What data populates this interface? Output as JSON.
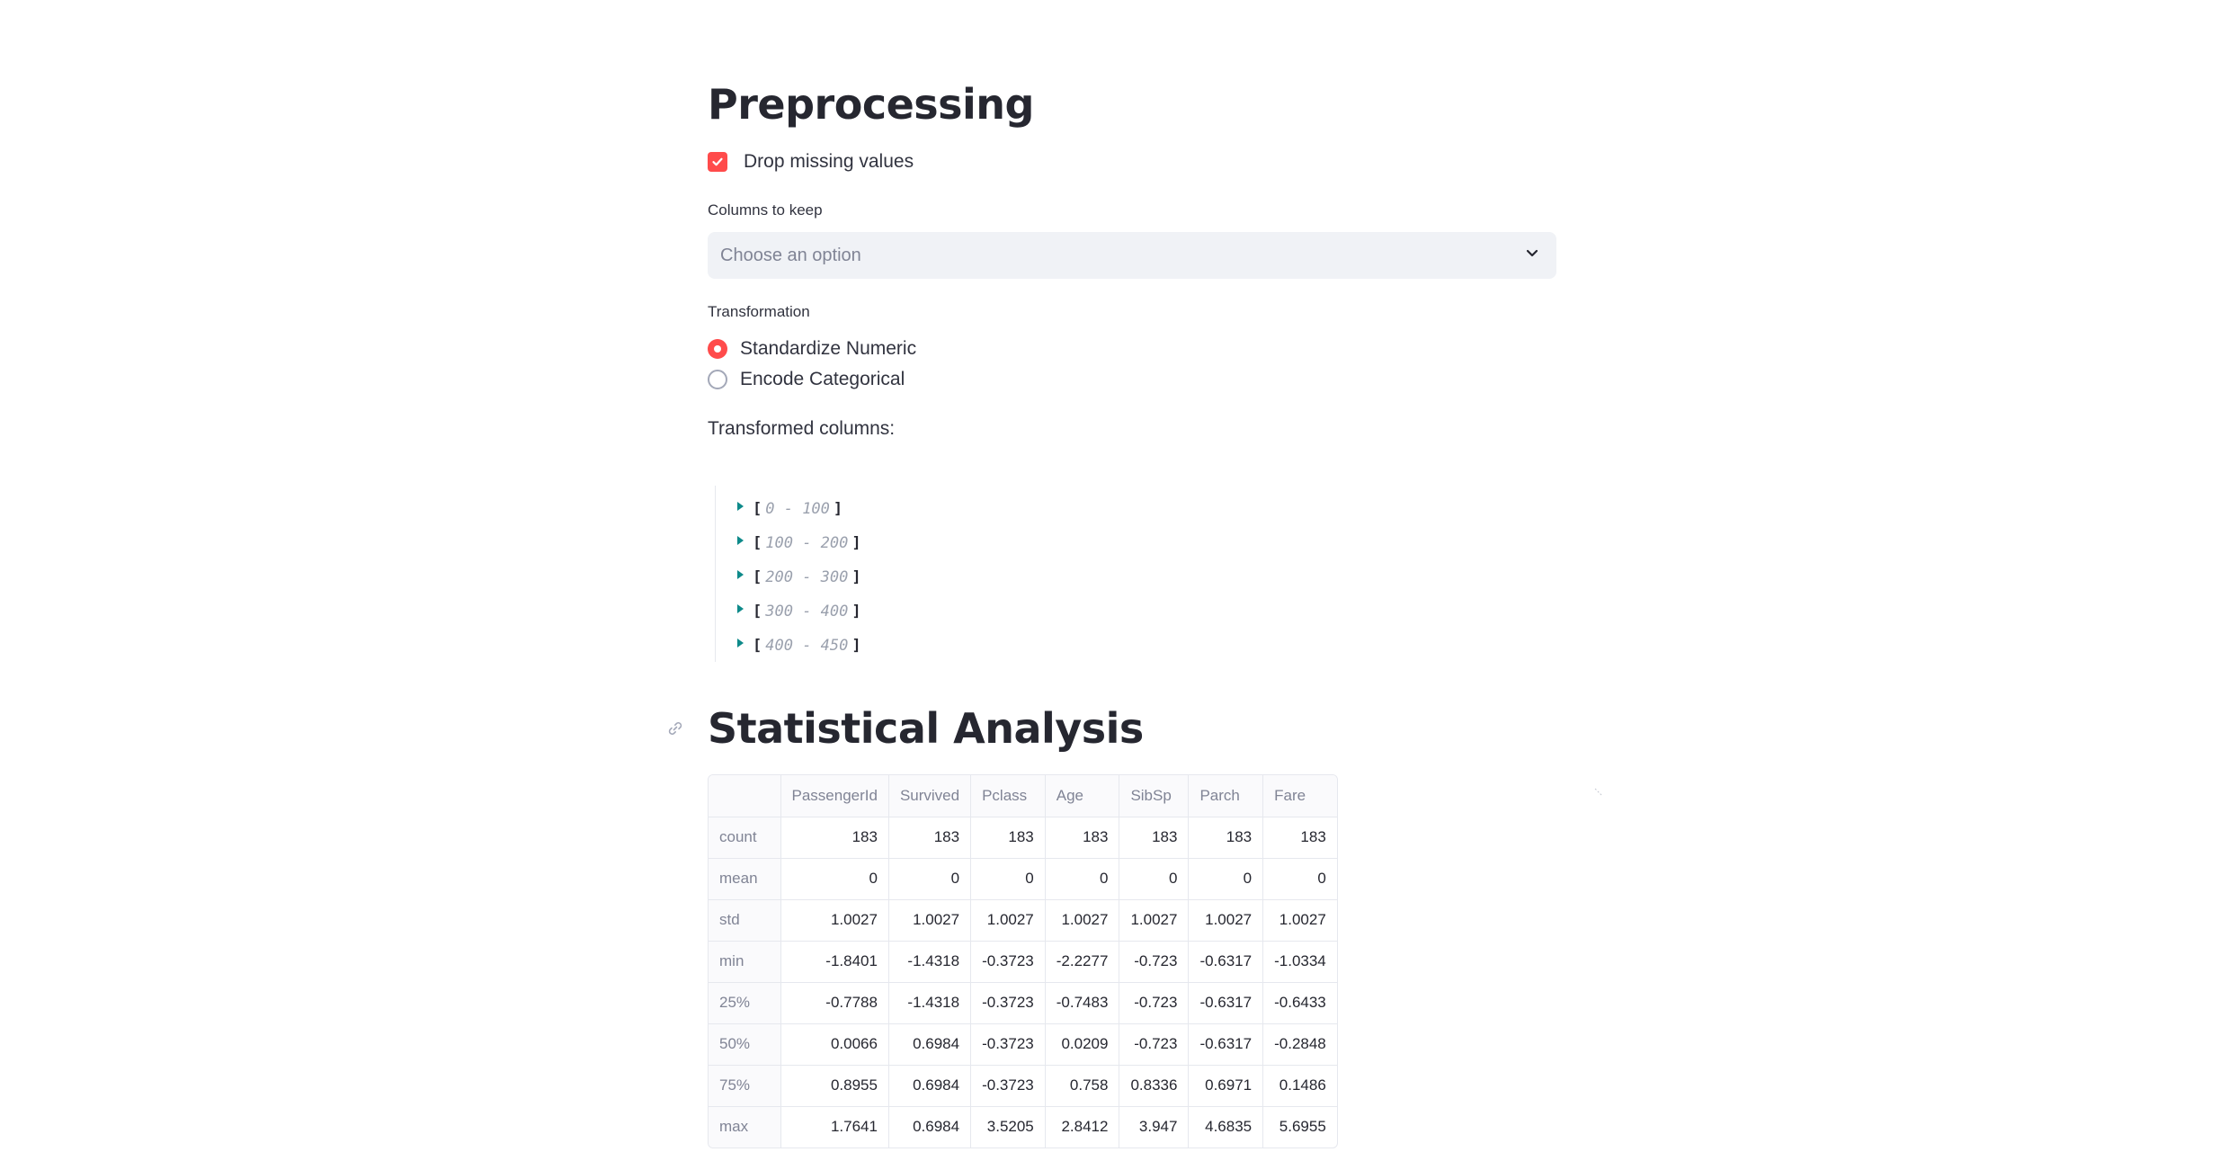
{
  "preprocessing": {
    "title": "Preprocessing",
    "drop_missing": {
      "label": "Drop missing values",
      "checked": true
    },
    "columns_to_keep": {
      "label": "Columns to keep",
      "placeholder": "Choose an option"
    },
    "transformation": {
      "label": "Transformation",
      "options": [
        {
          "label": "Standardize Numeric",
          "selected": true
        },
        {
          "label": "Encode Categorical",
          "selected": false
        }
      ]
    },
    "transformed_label": "Transformed columns:",
    "json_ranges": [
      "0 - 100",
      "100 - 200",
      "200 - 300",
      "300 - 400",
      "400 - 450"
    ]
  },
  "statistical_analysis": {
    "title": "Statistical Analysis",
    "table": {
      "columns": [
        "",
        "PassengerId",
        "Survived",
        "Pclass",
        "Age",
        "SibSp",
        "Parch",
        "Fare"
      ],
      "rows": [
        {
          "label": "count",
          "values": [
            "183",
            "183",
            "183",
            "183",
            "183",
            "183",
            "183"
          ]
        },
        {
          "label": "mean",
          "values": [
            "0",
            "0",
            "0",
            "0",
            "0",
            "0",
            "0"
          ]
        },
        {
          "label": "std",
          "values": [
            "1.0027",
            "1.0027",
            "1.0027",
            "1.0027",
            "1.0027",
            "1.0027",
            "1.0027"
          ]
        },
        {
          "label": "min",
          "values": [
            "-1.8401",
            "-1.4318",
            "-0.3723",
            "-2.2277",
            "-0.723",
            "-0.6317",
            "-1.0334"
          ]
        },
        {
          "label": "25%",
          "values": [
            "-0.7788",
            "-1.4318",
            "-0.3723",
            "-0.7483",
            "-0.723",
            "-0.6317",
            "-0.6433"
          ]
        },
        {
          "label": "50%",
          "values": [
            "0.0066",
            "0.6984",
            "-0.3723",
            "0.0209",
            "-0.723",
            "-0.6317",
            "-0.2848"
          ]
        },
        {
          "label": "75%",
          "values": [
            "0.8955",
            "0.6984",
            "-0.3723",
            "0.758",
            "0.8336",
            "0.6971",
            "0.1486"
          ]
        },
        {
          "label": "max",
          "values": [
            "1.7641",
            "0.6984",
            "3.5205",
            "2.8412",
            "3.947",
            "4.6835",
            "5.6955"
          ]
        }
      ]
    }
  },
  "colors": {
    "accent": "#ff4b4b",
    "json_toggle": "#0e8a8a",
    "input_bg": "#f0f2f6"
  }
}
